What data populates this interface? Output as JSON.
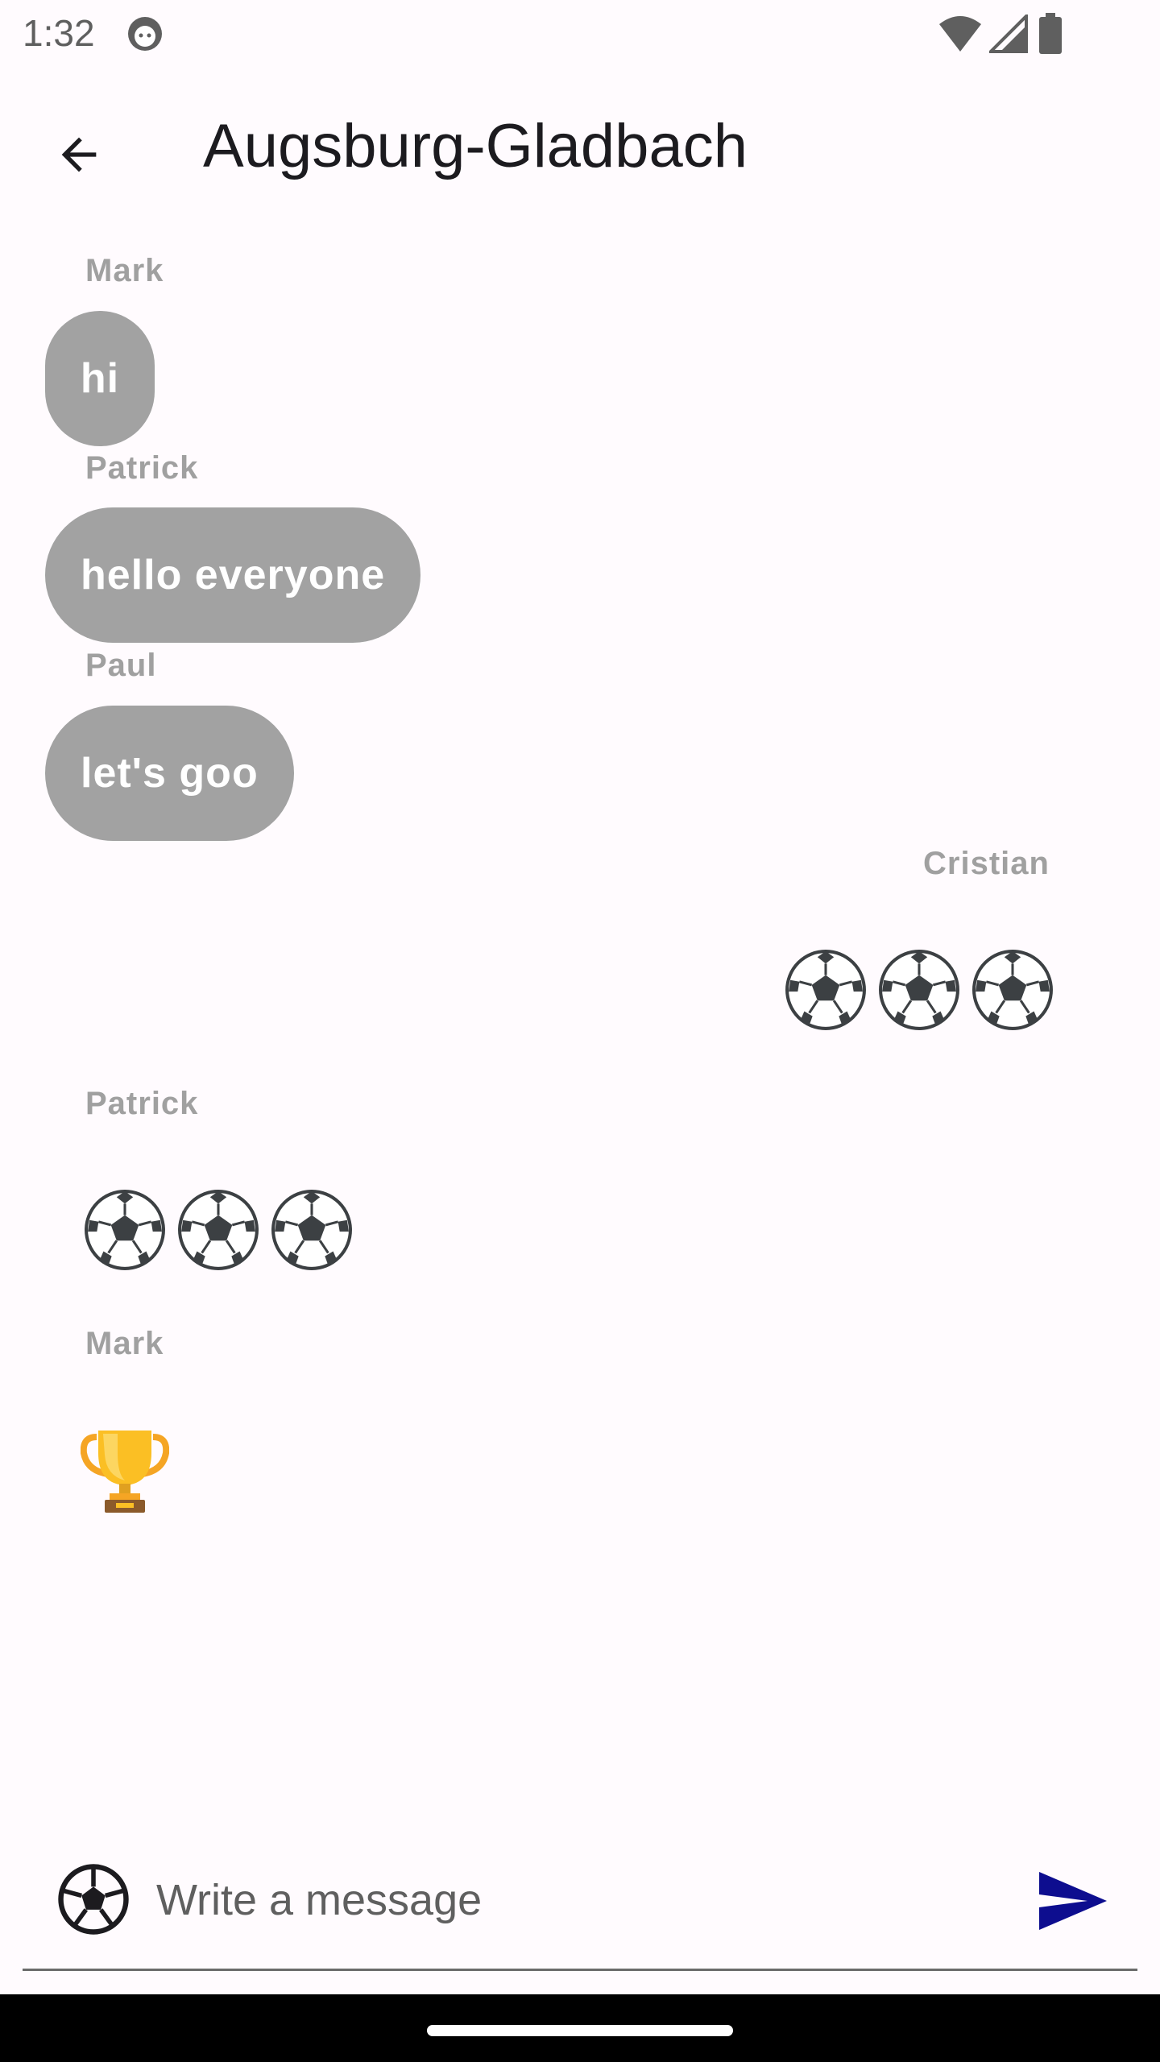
{
  "status_bar": {
    "time": "1:32",
    "icons": [
      "app-notification-icon",
      "wifi-icon",
      "signal-icon",
      "battery-icon"
    ]
  },
  "app_bar": {
    "back_icon": "arrow-back-icon",
    "title": "Augsburg-Gladbach"
  },
  "messages": [
    {
      "sender": "Mark",
      "text": "hi",
      "side": "left",
      "kind": "text"
    },
    {
      "sender": "Patrick",
      "text": "hello everyone",
      "side": "left",
      "kind": "text"
    },
    {
      "sender": "Paul",
      "text": "let's goo",
      "side": "left",
      "kind": "text"
    },
    {
      "sender": "Cristian",
      "text": "⚽⚽⚽",
      "side": "right",
      "kind": "emoji"
    },
    {
      "sender": "Patrick",
      "text": "⚽⚽⚽",
      "side": "left",
      "kind": "emoji"
    },
    {
      "sender": "Mark",
      "text": "🏆",
      "side": "left",
      "kind": "emoji"
    }
  ],
  "composer": {
    "emoji_icon": "soccer-ball-icon",
    "placeholder": "Write a message",
    "value": "",
    "send_icon": "send-icon"
  },
  "colors": {
    "background": "#fffbfe",
    "bubble": "#a2a2a2",
    "sender_label": "#a0a0a0",
    "send_accent": "#0d0d8f"
  }
}
